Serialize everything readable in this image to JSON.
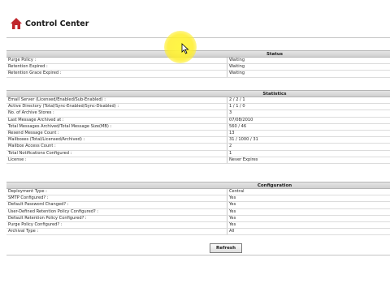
{
  "header": {
    "title": "Control Center",
    "icon": "home-icon"
  },
  "status": {
    "heading": "Status",
    "rows": [
      {
        "label": "Purge Policy :",
        "value": "Waiting"
      },
      {
        "label": "Retention Expired :",
        "value": "Waiting"
      },
      {
        "label": "Retention Grace Expired :",
        "value": "Waiting"
      }
    ]
  },
  "statistics": {
    "heading": "Statistics",
    "rows": [
      {
        "label": "Email Server (Licensed/Enabled/Sub-Enabled) :",
        "value": "2 / 2 / 1"
      },
      {
        "label": "Active Directory (Total/Sync-Enabled/Sync-Disabled) :",
        "value": "1 / 1 / 0"
      },
      {
        "label": "No. of Archive Stores :",
        "value": "3"
      },
      {
        "label": "Last Message Archived at :",
        "value": "07/08/2010"
      },
      {
        "label": "Total Messages Archived/Total Message Size(MB) :",
        "value": "560 / 46"
      },
      {
        "label": "Resend Message Count :",
        "value": "13"
      },
      {
        "label": "Mailboxes (Total/Licensed/Archived) :",
        "value": "31 / 1000 / 31"
      },
      {
        "label": "Mailbox Access Count :",
        "value": "2"
      },
      {
        "label": "Total Notifications Configured :",
        "value": "1"
      },
      {
        "label": "License :",
        "value": "Never Expires"
      }
    ]
  },
  "configuration": {
    "heading": "Configuration",
    "rows": [
      {
        "label": "Deployment Type :",
        "value": "Central"
      },
      {
        "label": "SMTP Configured? :",
        "value": "Yes"
      },
      {
        "label": "Default Password Changed? :",
        "value": "Yes"
      },
      {
        "label": "User-Defined Retention Policy Configured? :",
        "value": "Yes"
      },
      {
        "label": "Default Retention Policy Configured? :",
        "value": "Yes"
      },
      {
        "label": "Purge Policy Configured? :",
        "value": "Yes"
      },
      {
        "label": "Archival Type :",
        "value": "All"
      }
    ]
  },
  "actions": {
    "refresh_label": "Refresh"
  }
}
